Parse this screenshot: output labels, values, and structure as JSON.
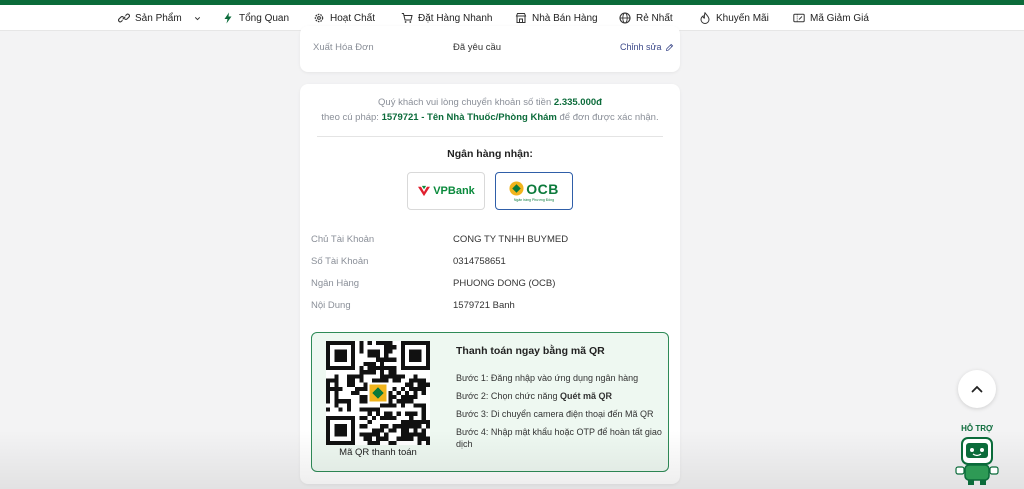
{
  "nav": {
    "items": [
      {
        "label": "Sản Phẩm"
      },
      {
        "label": "Tổng Quan"
      },
      {
        "label": "Hoạt Chất"
      },
      {
        "label": "Đặt Hàng Nhanh"
      },
      {
        "label": "Nhà Bán Hàng"
      },
      {
        "label": "Rẻ Nhất"
      },
      {
        "label": "Khuyến Mãi"
      },
      {
        "label": "Mã Giảm Giá"
      }
    ]
  },
  "invoice": {
    "label": "Xuất Hóa Đơn",
    "value": "Đã yêu cầu",
    "edit_label": "Chỉnh sửa"
  },
  "transfer": {
    "line1_prefix": "Quý khách vui lòng chuyển khoản số tiền",
    "amount": "2.335.000đ",
    "line2_prefix": "theo cú pháp:",
    "syntax": "1579721 - Tên Nhà Thuốc/Phòng Khám",
    "line2_suffix": "để đơn được xác nhận."
  },
  "bank_select": {
    "title": "Ngân hàng nhận:",
    "banks": [
      {
        "name": "VPBank",
        "selected": false
      },
      {
        "name": "OCB",
        "tagline": "Ngân hàng Phương Đông",
        "selected": true
      }
    ]
  },
  "account": {
    "rows": [
      {
        "label": "Chủ Tài Khoản",
        "value": "CONG TY TNHH BUYMED"
      },
      {
        "label": "Số Tài Khoản",
        "value": "0314758651"
      },
      {
        "label": "Ngân Hàng",
        "value": "PHUONG DONG (OCB)"
      },
      {
        "label": "Nội Dung",
        "value": "1579721 Banh"
      }
    ]
  },
  "qr": {
    "title": "Thanh toán ngay bằng mã QR",
    "caption": "Mã QR thanh toán",
    "step1": "Bước 1: Đăng nhập vào ứng dụng ngân hàng",
    "step2_prefix": "Bước 2: Chọn chức năng",
    "step2_bold": "Quét mã QR",
    "step3": "Bước 3: Di chuyển camera điện thoại đến Mã QR",
    "step4_line1": "Bước 4: Nhập mật khẩu hoặc OTP để hoàn tất giao",
    "step4_line2": "dịch"
  },
  "support": {
    "label": "HỖ TRỢ"
  },
  "colors": {
    "brand_green": "#0b6b3a",
    "qr_bg": "#eef8f1",
    "qr_border": "#2e8b57",
    "selected_border": "#2f5ea8",
    "vpbank_green": "#0a8a3c",
    "vpbank_red": "#e0202f",
    "ocb_green": "#0b7a3b",
    "ocb_yellow": "#f1b41c"
  }
}
